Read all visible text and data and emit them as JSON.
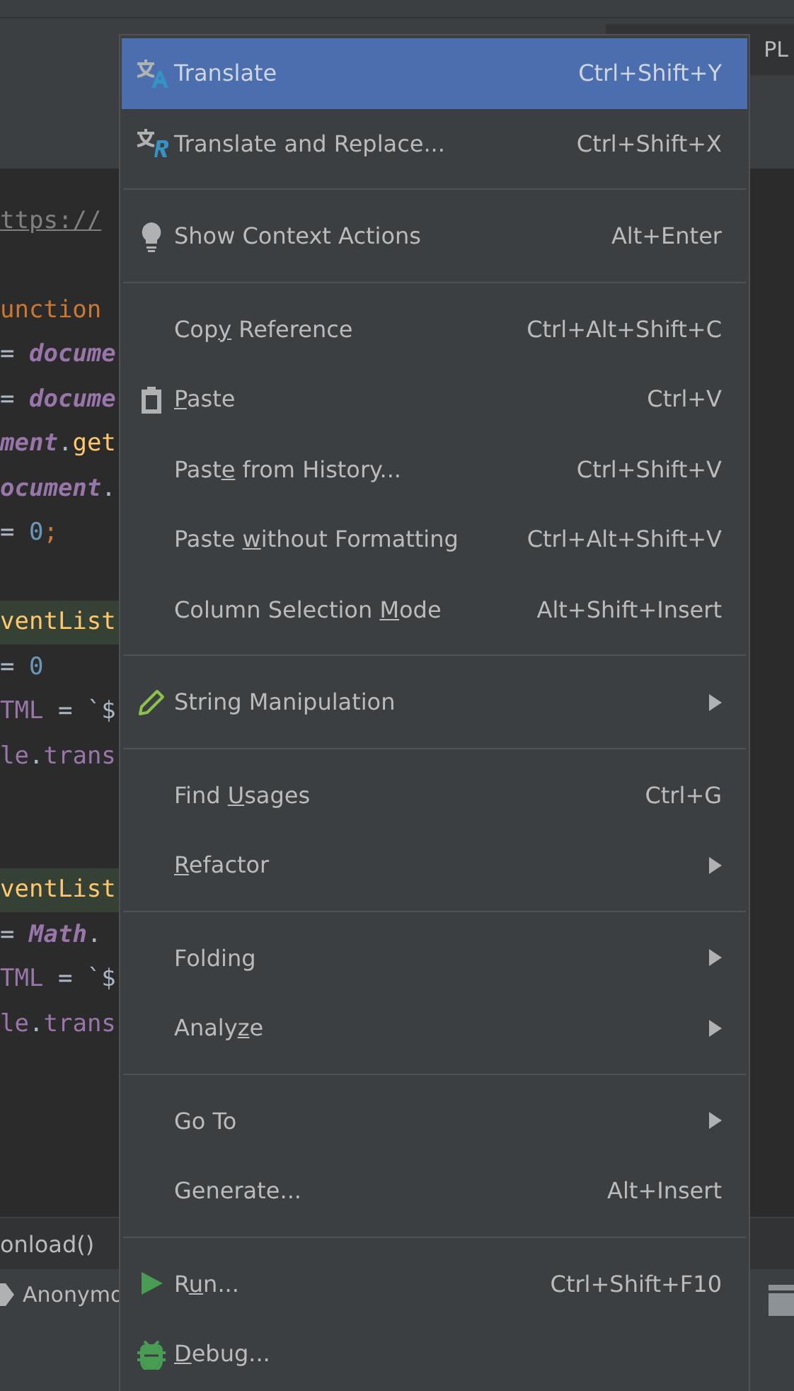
{
  "top_tab": {
    "label": "PL"
  },
  "code_lines": [
    {
      "highlighted": false,
      "tokens": [
        {
          "kind": "link",
          "text": "ttps://"
        }
      ]
    },
    {
      "highlighted": false
    },
    {
      "highlighted": false,
      "tokens": [
        {
          "kind": "keyword",
          "text": "unction"
        }
      ]
    },
    {
      "highlighted": false,
      "tokens": [
        {
          "kind": "plain",
          "text": "= "
        },
        {
          "kind": "global",
          "text": "docume"
        }
      ]
    },
    {
      "highlighted": false,
      "tokens": [
        {
          "kind": "plain",
          "text": "= "
        },
        {
          "kind": "global",
          "text": "docume"
        }
      ]
    },
    {
      "highlighted": false,
      "tokens": [
        {
          "kind": "global",
          "text": "ment"
        },
        {
          "kind": "plain",
          "text": "."
        },
        {
          "kind": "method",
          "text": "get"
        }
      ]
    },
    {
      "highlighted": false,
      "tokens": [
        {
          "kind": "global",
          "text": "ocument"
        },
        {
          "kind": "plain",
          "text": "."
        }
      ]
    },
    {
      "highlighted": false,
      "tokens": [
        {
          "kind": "plain",
          "text": "= "
        },
        {
          "kind": "number",
          "text": "0"
        },
        {
          "kind": "keyword",
          "text": ";"
        }
      ]
    },
    {
      "highlighted": false
    },
    {
      "highlighted": true,
      "tokens": [
        {
          "kind": "method",
          "text": "ventList"
        }
      ]
    },
    {
      "highlighted": false,
      "tokens": [
        {
          "kind": "plain",
          "text": "= "
        },
        {
          "kind": "number",
          "text": "0"
        }
      ]
    },
    {
      "highlighted": false,
      "tokens": [
        {
          "kind": "field",
          "text": "TML"
        },
        {
          "kind": "plain",
          "text": " = `$"
        }
      ]
    },
    {
      "highlighted": false,
      "tokens": [
        {
          "kind": "field",
          "text": "le"
        },
        {
          "kind": "plain",
          "text": "."
        },
        {
          "kind": "field",
          "text": "trans"
        }
      ]
    },
    {
      "highlighted": false
    },
    {
      "highlighted": false
    },
    {
      "highlighted": true,
      "tokens": [
        {
          "kind": "method",
          "text": "ventList"
        }
      ]
    },
    {
      "highlighted": false,
      "tokens": [
        {
          "kind": "plain",
          "text": "= "
        },
        {
          "kind": "global",
          "text": "Math"
        },
        {
          "kind": "plain",
          "text": "."
        }
      ]
    },
    {
      "highlighted": false,
      "tokens": [
        {
          "kind": "field",
          "text": "TML"
        },
        {
          "kind": "plain",
          "text": " = `$"
        }
      ]
    },
    {
      "highlighted": false,
      "tokens": [
        {
          "kind": "field",
          "text": "le"
        },
        {
          "kind": "plain",
          "text": "."
        },
        {
          "kind": "field",
          "text": "trans"
        }
      ]
    }
  ],
  "breadcrumb": "onload()",
  "bottom_item": {
    "label": "Anonymo"
  },
  "menu": {
    "groups": [
      [
        {
          "kind": "translate",
          "label": {
            "before": "Translate"
          },
          "shortcut": "Ctrl+Shift+Y",
          "submenu": false,
          "selected": true
        },
        {
          "kind": "translate-replace",
          "label": {
            "before": "Translate and Replace..."
          },
          "shortcut": "Ctrl+Shift+X",
          "submenu": false,
          "selected": false
        }
      ],
      [
        {
          "kind": "bulb",
          "label": {
            "before": "Show Context Actions"
          },
          "shortcut": "Alt+Enter",
          "submenu": false,
          "selected": false
        }
      ],
      [
        {
          "kind": "plain",
          "label": {
            "before": "Cop",
            "key": "y",
            "after": " Reference"
          },
          "shortcut": "Ctrl+Alt+Shift+C",
          "submenu": false,
          "selected": false
        },
        {
          "kind": "clipboard",
          "label": {
            "key": "P",
            "after": "aste"
          },
          "shortcut": "Ctrl+V",
          "submenu": false,
          "selected": false
        },
        {
          "kind": "plain",
          "label": {
            "before": "Past",
            "key": "e",
            "after": " from History..."
          },
          "shortcut": "Ctrl+Shift+V",
          "submenu": false,
          "selected": false
        },
        {
          "kind": "plain",
          "label": {
            "before": "Paste ",
            "key": "w",
            "after": "ithout Formatting"
          },
          "shortcut": "Ctrl+Alt+Shift+V",
          "submenu": false,
          "selected": false
        },
        {
          "kind": "plain",
          "label": {
            "before": "Column Selection ",
            "key": "M",
            "after": "ode"
          },
          "shortcut": "Alt+Shift+Insert",
          "submenu": false,
          "selected": false
        }
      ],
      [
        {
          "kind": "pencil",
          "label": {
            "before": "String Manipulation"
          },
          "submenu": true,
          "selected": false
        }
      ],
      [
        {
          "kind": "plain",
          "label": {
            "before": "Find ",
            "key": "U",
            "after": "sages"
          },
          "shortcut": "Ctrl+G",
          "submenu": false,
          "selected": false
        },
        {
          "kind": "plain",
          "label": {
            "key": "R",
            "after": "efactor"
          },
          "submenu": true,
          "selected": false
        }
      ],
      [
        {
          "kind": "plain",
          "label": {
            "before": "Folding"
          },
          "submenu": true,
          "selected": false
        },
        {
          "kind": "plain",
          "label": {
            "before": "Analy",
            "key": "z",
            "after": "e"
          },
          "submenu": true,
          "selected": false
        }
      ],
      [
        {
          "kind": "plain",
          "label": {
            "before": "Go To"
          },
          "submenu": true,
          "selected": false
        },
        {
          "kind": "plain",
          "label": {
            "before": "Generate..."
          },
          "shortcut": "Alt+Insert",
          "submenu": false,
          "selected": false
        }
      ],
      [
        {
          "kind": "run",
          "label": {
            "before": "R",
            "key": "u",
            "after": "n..."
          },
          "shortcut": "Ctrl+Shift+F10",
          "submenu": false,
          "selected": false
        },
        {
          "kind": "bug",
          "label": {
            "key": "D",
            "after": "ebug..."
          },
          "submenu": false,
          "selected": false
        }
      ]
    ]
  }
}
